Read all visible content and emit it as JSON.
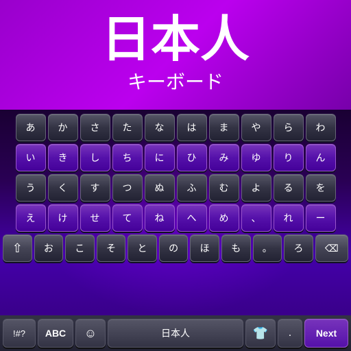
{
  "header": {
    "title_kanji": "日本人",
    "title_sub": "キーボード"
  },
  "keyboard": {
    "rows": [
      [
        "あ",
        "か",
        "さ",
        "た",
        "な",
        "は",
        "ま",
        "や",
        "ら",
        "わ"
      ],
      [
        "い",
        "き",
        "し",
        "ち",
        "に",
        "ひ",
        "み",
        "ゆ",
        "り",
        "ん"
      ],
      [
        "う",
        "く",
        "す",
        "つ",
        "ぬ",
        "ふ",
        "む",
        "よ",
        "る",
        "を"
      ],
      [
        "え",
        "け",
        "せ",
        "て",
        "ね",
        "へ",
        "め",
        "、",
        "れ",
        "ー"
      ],
      [
        "↑",
        "お",
        "こ",
        "そ",
        "と",
        "の",
        "ほ",
        "も",
        "。",
        "ろ",
        "⌫"
      ]
    ]
  },
  "toolbar": {
    "sym_label": "!#?",
    "abc_label": "ABC",
    "emoji_label": "☺",
    "lang_label": "日本人",
    "shirt_label": "👕",
    "dot_label": ".",
    "next_label": "Next"
  }
}
